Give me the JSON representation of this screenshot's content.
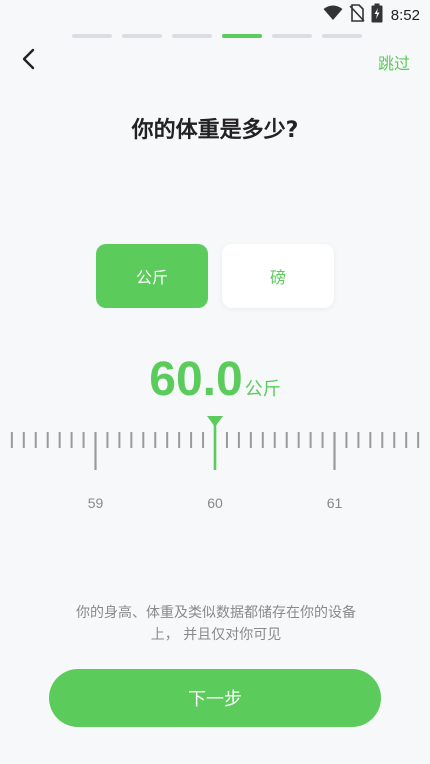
{
  "status_bar": {
    "time": "8:52"
  },
  "icons": {
    "wifi": "wifi-icon",
    "no_sim": "no-sim-icon",
    "battery": "battery-charging-icon",
    "back": "chevron-left-icon",
    "pointer": "triangle-down-icon"
  },
  "progress": {
    "total_steps": 6,
    "current_step": 4
  },
  "header": {
    "skip_label": "跳过"
  },
  "question": {
    "title": "你的体重是多少?"
  },
  "units": {
    "kg_label": "公斤",
    "lb_label": "磅",
    "selected": "kg"
  },
  "weight": {
    "value": "60.0",
    "unit": "公斤"
  },
  "ruler": {
    "labels": [
      "59",
      "60",
      "61"
    ],
    "current_value": 60.0,
    "min_visible": 58.2,
    "max_visible": 61.8,
    "step": 0.1
  },
  "privacy": {
    "text": "你的身高、体重及类似数据都储存在你的设备上， 并且仅对你可见"
  },
  "footer": {
    "next_label": "下一步"
  },
  "colors": {
    "accent": "#5bcb5b",
    "tick": "#9a9a9a",
    "background": "#f7f8fa"
  }
}
